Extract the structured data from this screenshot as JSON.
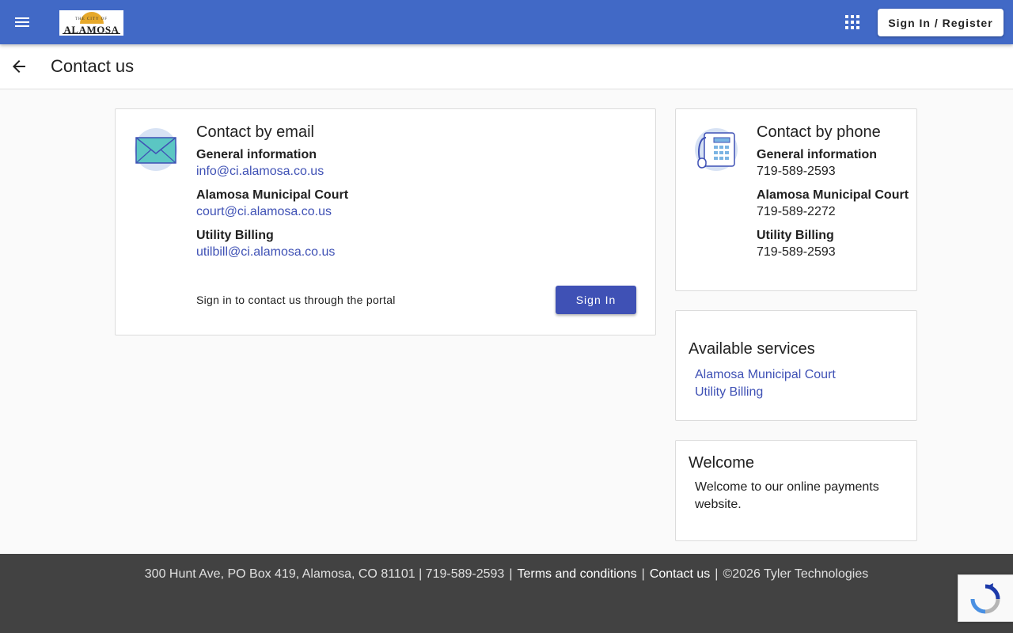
{
  "header": {
    "logo": {
      "arc_text": "THE CITY OF",
      "name": "ALAMOSA"
    },
    "signin_register_label": "Sign In / Register",
    "icons": {
      "menu": "hamburger-menu-icon",
      "apps": "apps-grid-icon"
    },
    "colors": {
      "bar": "#4169c6"
    }
  },
  "titlebar": {
    "title": "Contact us",
    "back_icon": "arrow-left-icon"
  },
  "email_card": {
    "title": "Contact by email",
    "icon": "envelope-icon",
    "entries": [
      {
        "label": "General information",
        "email": "info@ci.alamosa.co.us"
      },
      {
        "label": "Alamosa Municipal Court",
        "email": "court@ci.alamosa.co.us"
      },
      {
        "label": "Utility Billing",
        "email": "utilbill@ci.alamosa.co.us"
      }
    ],
    "portal_text": "Sign in to contact us through the portal",
    "signin_label": "Sign In"
  },
  "phone_card": {
    "title": "Contact by phone",
    "icon": "telephone-icon",
    "entries": [
      {
        "label": "General information",
        "phone": "719-589-2593"
      },
      {
        "label": "Alamosa Municipal Court",
        "phone": "719-589-2272"
      },
      {
        "label": "Utility Billing",
        "phone": "719-589-2593"
      }
    ]
  },
  "services_card": {
    "title": "Available services",
    "items": [
      "Alamosa Municipal Court",
      "Utility Billing"
    ]
  },
  "welcome_card": {
    "title": "Welcome",
    "text": "Welcome to our online payments website."
  },
  "footer": {
    "address": "300 Hunt Ave, PO Box 419, Alamosa, CO 81101 | 719-589-2593",
    "terms": "Terms and conditions",
    "contact": "Contact us",
    "copyright": "©2026 Tyler Technologies",
    "separator": "|"
  },
  "colors": {
    "link": "#3f51b5",
    "primary_button": "#3f51b5",
    "footer_bg": "#424242"
  }
}
